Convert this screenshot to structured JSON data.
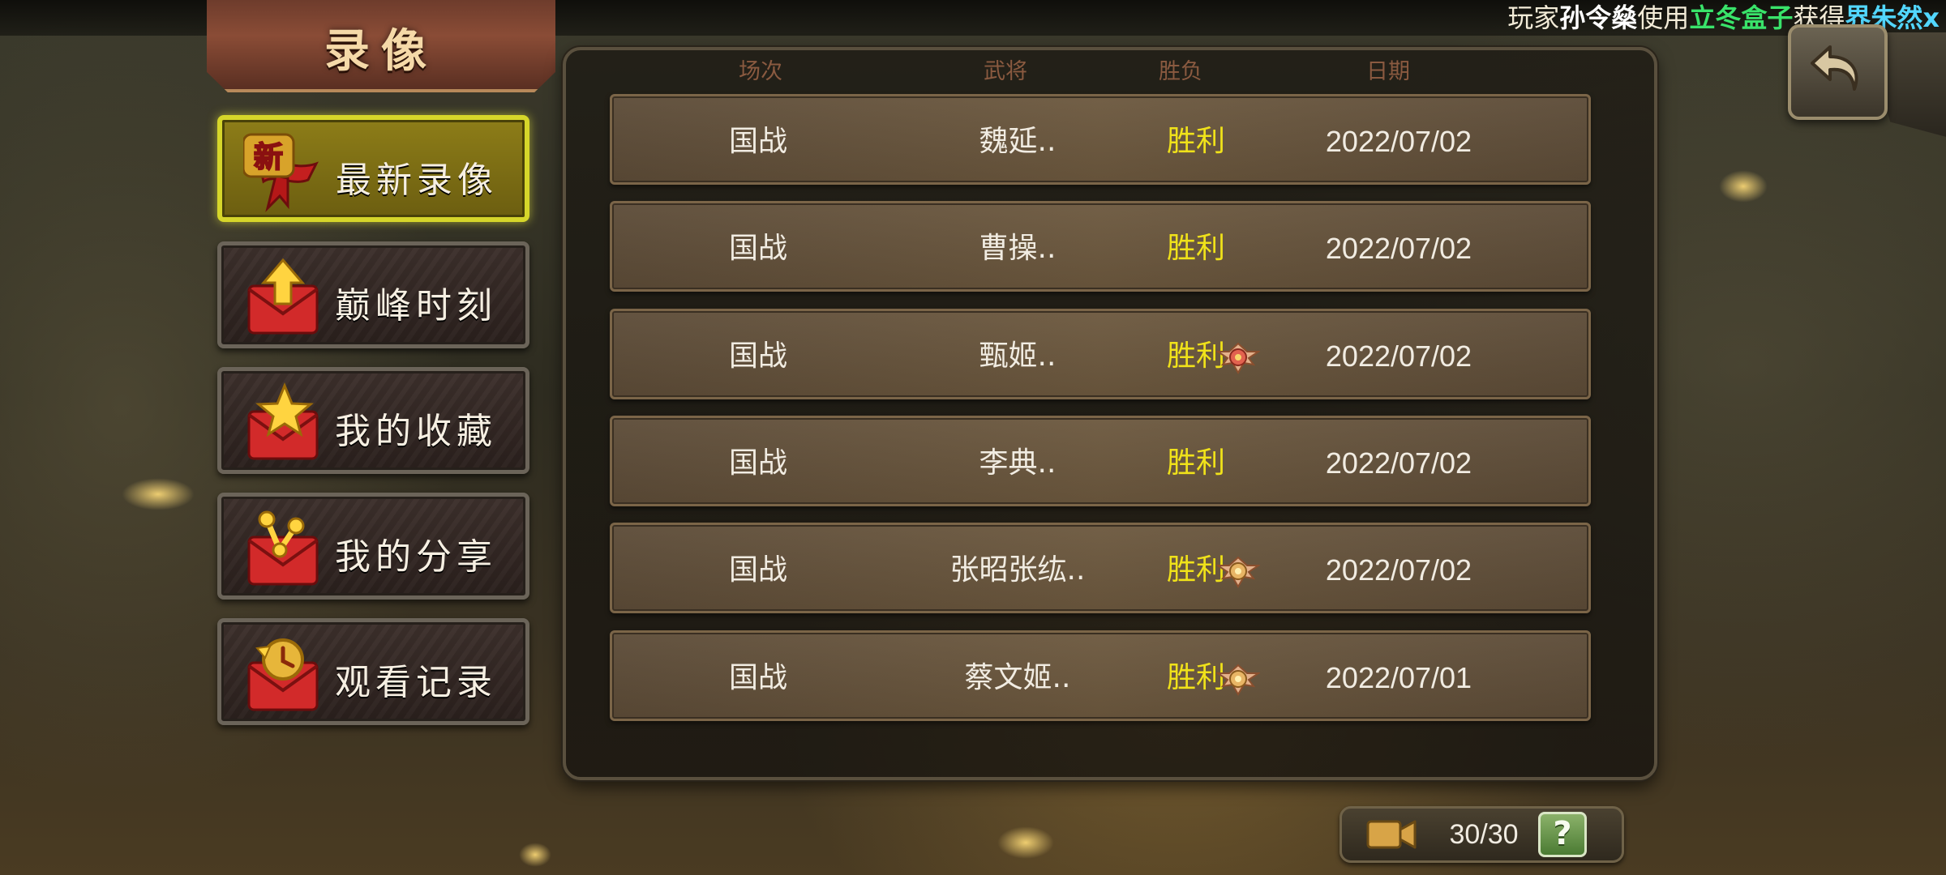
{
  "notice": {
    "prefix": "玩家",
    "player": "孙令燊",
    "verb": "使用",
    "item": "立冬盒子",
    "get": "获得",
    "reward": "界朱然x"
  },
  "page_title": "录像",
  "menu": [
    {
      "label": "最新录像",
      "icon": "new-ribbon-icon",
      "active": true
    },
    {
      "label": "巅峰时刻",
      "icon": "red-envelope-up-arrow-icon",
      "active": false
    },
    {
      "label": "我的收藏",
      "icon": "red-envelope-star-icon",
      "active": false
    },
    {
      "label": "我的分享",
      "icon": "red-envelope-share-icon",
      "active": false
    },
    {
      "label": "观看记录",
      "icon": "red-envelope-history-icon",
      "active": false
    }
  ],
  "table": {
    "headers": {
      "mode": "场次",
      "general": "武将",
      "result": "胜负",
      "date": "日期"
    },
    "rows": [
      {
        "mode": "国战",
        "general": "魏延..",
        "result": "胜利",
        "badge": false,
        "date": "2022/07/02"
      },
      {
        "mode": "国战",
        "general": "曹操..",
        "result": "胜利",
        "badge": false,
        "date": "2022/07/02"
      },
      {
        "mode": "国战",
        "general": "甄姬..",
        "result": "胜利",
        "badge": true,
        "date": "2022/07/02"
      },
      {
        "mode": "国战",
        "general": "李典..",
        "result": "胜利",
        "badge": false,
        "date": "2022/07/02"
      },
      {
        "mode": "国战",
        "general": "张昭张纮..",
        "result": "胜利",
        "badge": true,
        "date": "2022/07/02"
      },
      {
        "mode": "国战",
        "general": "蔡文姬..",
        "result": "胜利",
        "badge": true,
        "date": "2022/07/01"
      }
    ]
  },
  "counter": {
    "text": "30/30",
    "icon": "video-camera-icon"
  },
  "help": {
    "label": "?"
  },
  "back": {
    "icon": "back-arrow-icon"
  },
  "colors": {
    "accent_yellow": "#f0e21a",
    "active_border": "#d6d62a",
    "header_text": "#8a5a40"
  }
}
